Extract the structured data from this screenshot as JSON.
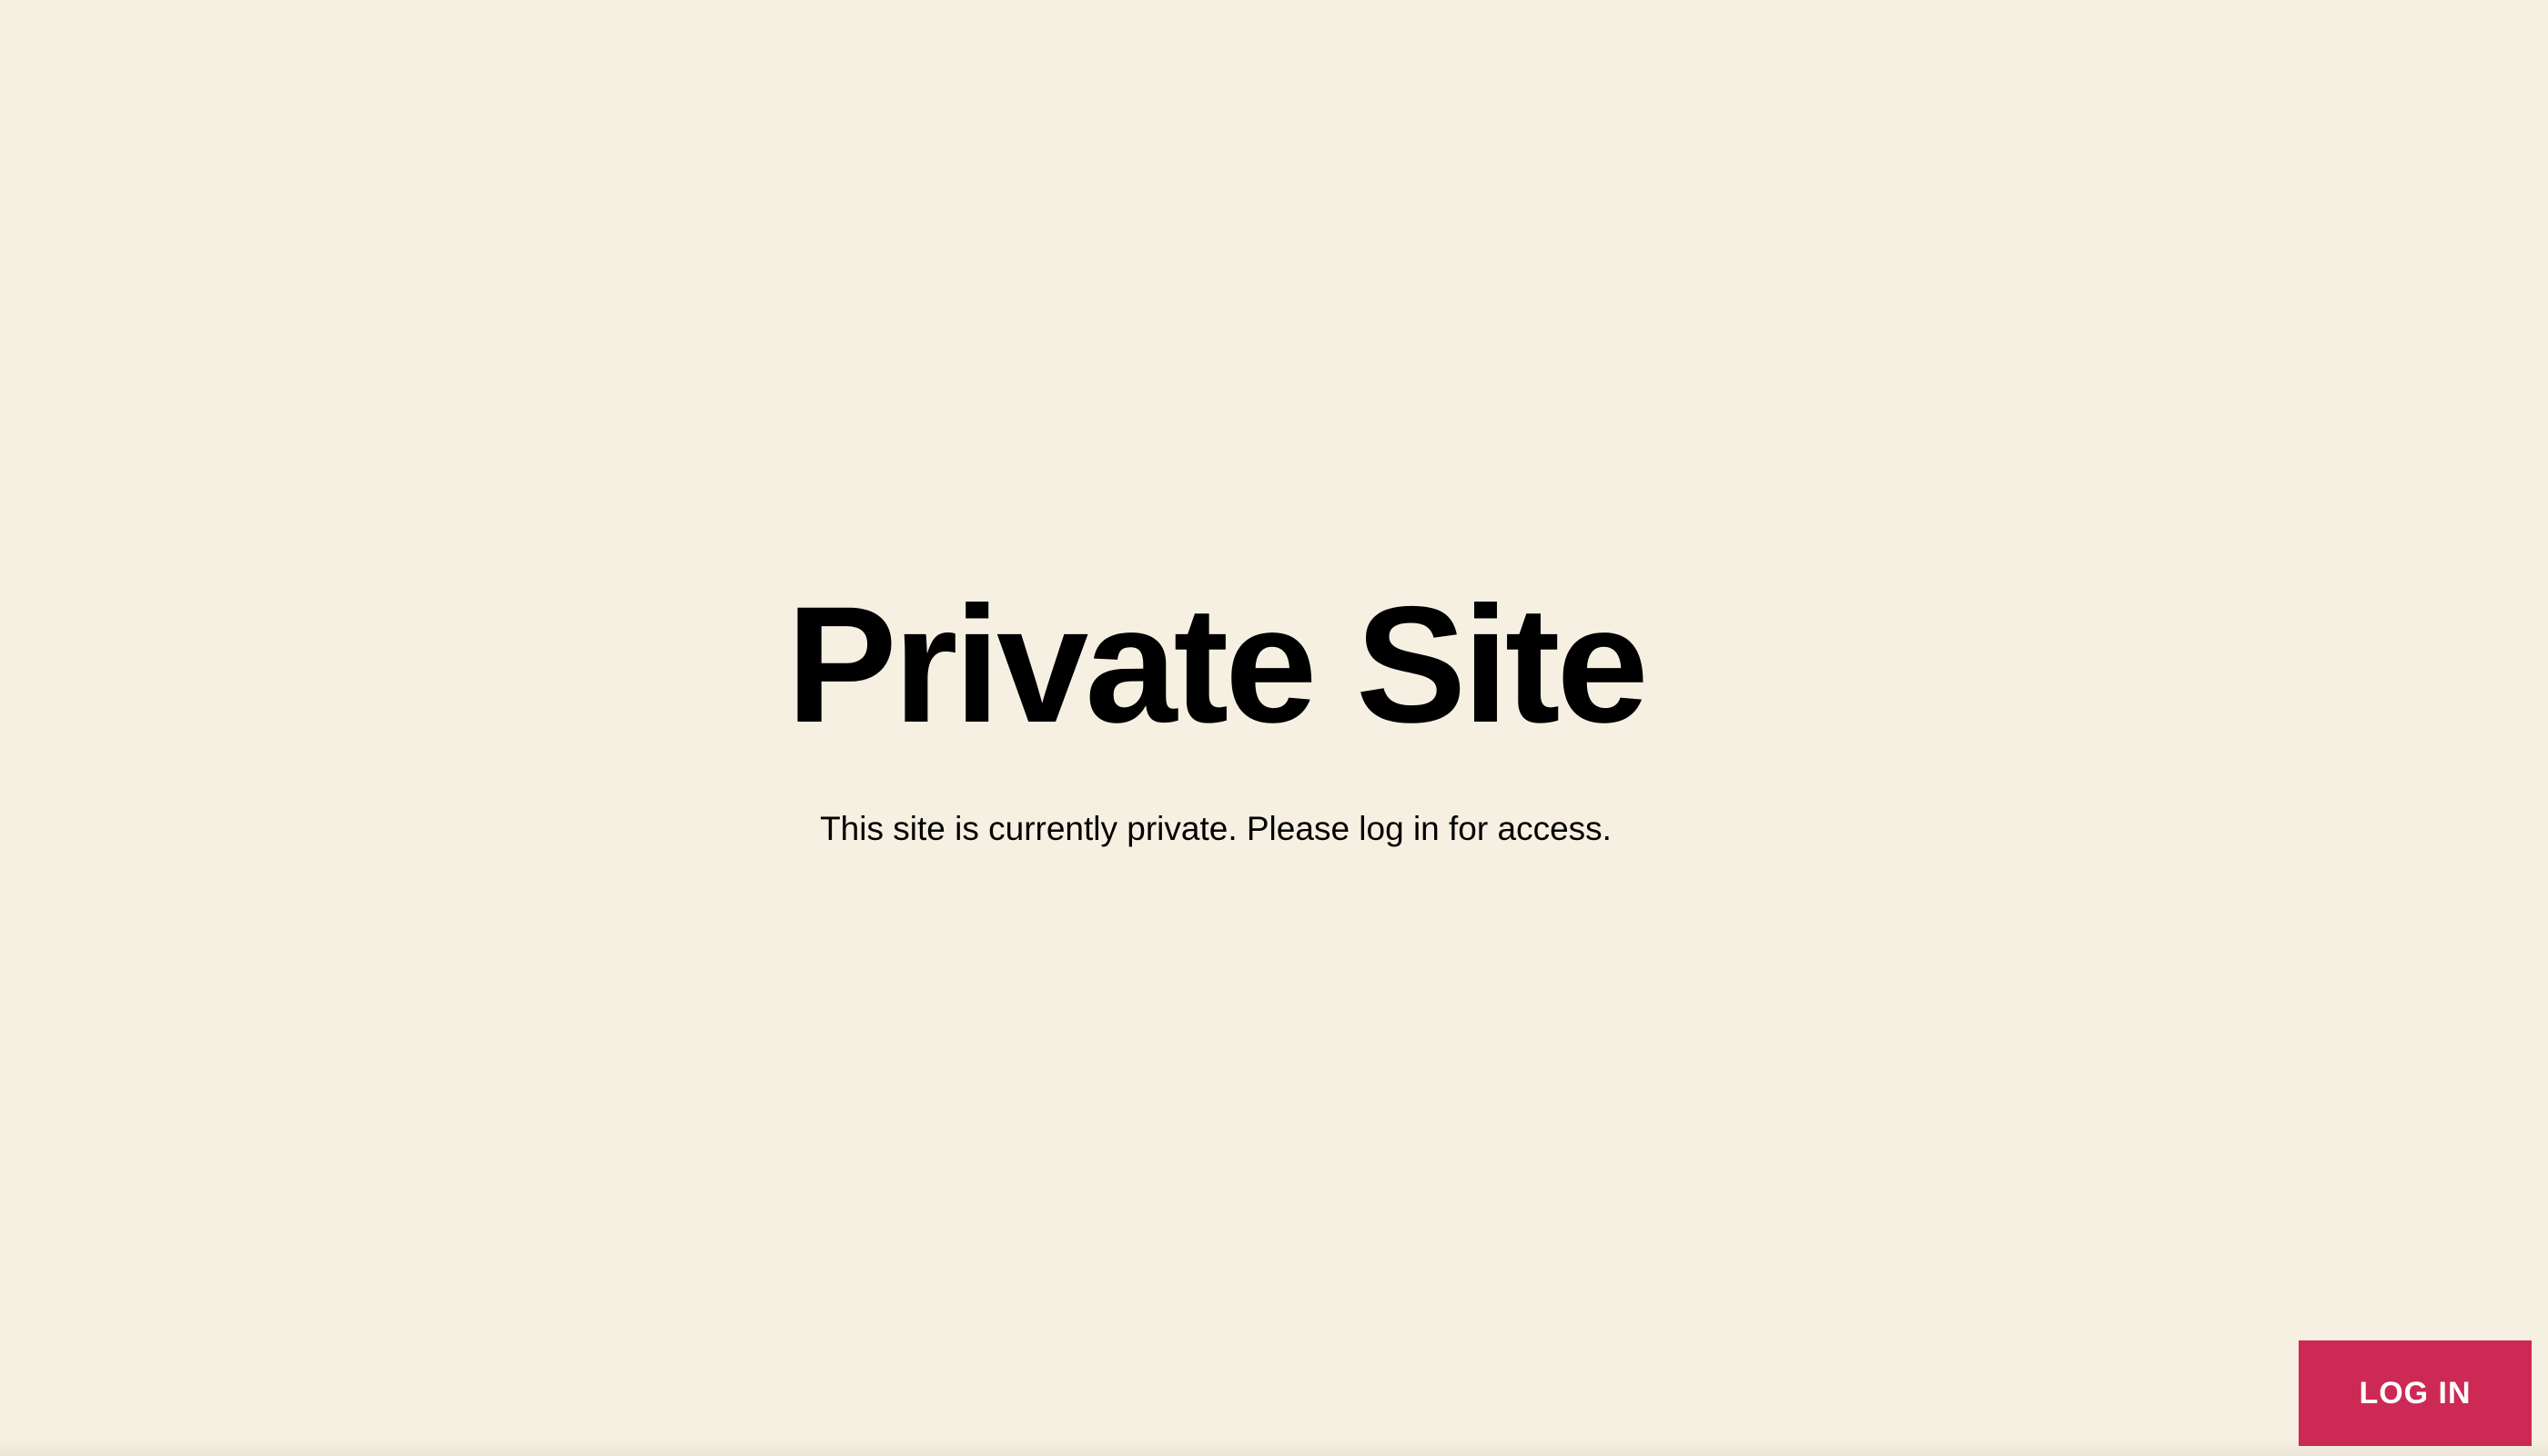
{
  "page": {
    "title": "Private Site",
    "message": "This site is currently private. Please log in for access."
  },
  "actions": {
    "login_label": "LOG IN"
  },
  "colors": {
    "background": "#f5f0e1",
    "text": "#000000",
    "accent": "#cc2954",
    "button_text": "#ffffff"
  }
}
